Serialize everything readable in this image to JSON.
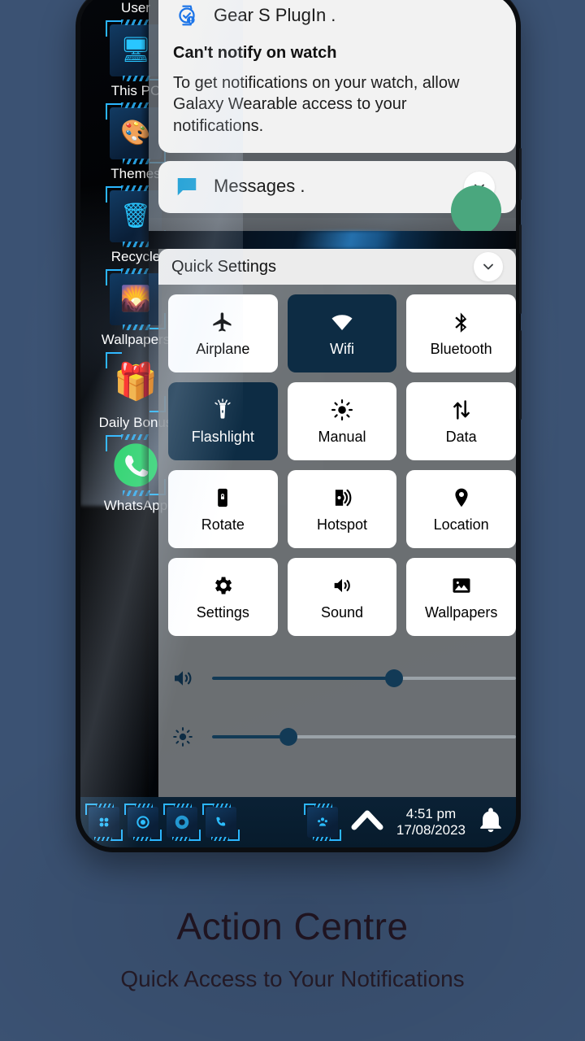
{
  "promo": {
    "title": "Action Centre",
    "subtitle": "Quick Access to Your Notifications"
  },
  "colors": {
    "page_background": "#3b5273",
    "tile_active_bg": "#0d2c44",
    "tile_inactive_bg": "#ffffff",
    "accent_cyan": "#2bbdff",
    "slider_fill": "#123a56",
    "avatar_green": "#4aa77e"
  },
  "desktop_icons": [
    {
      "label": "User",
      "icon": "user-icon",
      "glyph": "▲"
    },
    {
      "label": "This PC",
      "icon": "this-pc-icon",
      "glyph": "⬤"
    },
    {
      "label": "Themes",
      "icon": "themes-palette-icon",
      "glyph": "◐"
    },
    {
      "label": "Recycle",
      "icon": "recycle-bin-icon",
      "glyph": "♻"
    },
    {
      "label": "Wallpapers",
      "icon": "wallpapers-image-icon",
      "glyph": "⛰"
    },
    {
      "label": "Daily Bonus",
      "icon": "daily-bonus-gift-icon",
      "glyph": "🎁"
    },
    {
      "label": "WhatsApp",
      "icon": "whatsapp-icon",
      "glyph": "✆"
    }
  ],
  "notifications": [
    {
      "app_name": "Gear S PlugIn .",
      "app_icon": "watch-alert-icon",
      "title": "Can't notify on watch",
      "body": "To get notifications on your watch, allow Galaxy Wearable access to your notifications.",
      "has_chevron": false
    },
    {
      "app_name": "Messages .",
      "app_icon": "message-bubble-icon",
      "title": "",
      "body": "",
      "has_chevron": true
    }
  ],
  "quick_settings": {
    "header_title": "Quick Settings",
    "collapse_icon": "chevron-down-icon",
    "tiles": [
      {
        "label": "Airplane",
        "icon": "airplane-icon",
        "active": false
      },
      {
        "label": "Wifi",
        "icon": "wifi-icon",
        "active": true
      },
      {
        "label": "Bluetooth",
        "icon": "bluetooth-icon",
        "active": false
      },
      {
        "label": "Flashlight",
        "icon": "flashlight-icon",
        "active": true
      },
      {
        "label": "Manual",
        "icon": "brightness-sun-icon",
        "active": false
      },
      {
        "label": "Data",
        "icon": "data-arrows-icon",
        "active": false
      },
      {
        "label": "Rotate",
        "icon": "rotate-lock-icon",
        "active": false
      },
      {
        "label": "Hotspot",
        "icon": "hotspot-icon",
        "active": false
      },
      {
        "label": "Location",
        "icon": "location-pin-icon",
        "active": false
      },
      {
        "label": "Settings",
        "icon": "gear-icon",
        "active": false
      },
      {
        "label": "Sound",
        "icon": "speaker-icon",
        "active": false
      },
      {
        "label": "Wallpapers",
        "icon": "image-icon",
        "active": false
      }
    ],
    "sliders": [
      {
        "name": "volume",
        "icon": "volume-icon",
        "percent": 60
      },
      {
        "name": "brightness",
        "icon": "brightness-icon",
        "percent": 25
      }
    ]
  },
  "taskbar": {
    "left_icons": [
      {
        "name": "apps-grid-icon",
        "glyph": "∷"
      },
      {
        "name": "settings-ring-icon",
        "glyph": "◎"
      },
      {
        "name": "browser-icon",
        "glyph": "◔"
      },
      {
        "name": "phone-dialer-icon",
        "glyph": "✆"
      }
    ],
    "tray_icon": {
      "name": "people-icon",
      "glyph": "⛭"
    },
    "expand_icon": "chevron-up-icon",
    "time": "4:51 pm",
    "date": "17/08/2023",
    "notification_bell_icon": "bell-icon"
  }
}
